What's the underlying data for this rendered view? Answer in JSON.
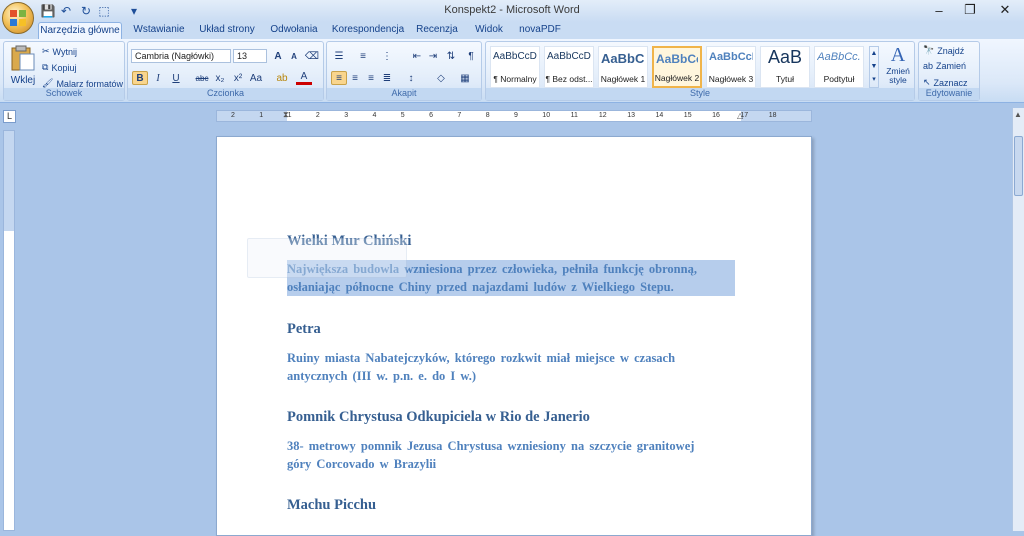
{
  "window": {
    "title": "Konspekt2 - Microsoft Word",
    "minimize": "–",
    "restore": "❐",
    "close": "✕"
  },
  "quick_access": {
    "save_icon": "save-icon",
    "undo_icon": "undo-icon",
    "redo_icon": "redo-icon",
    "customize_icon": "dropdown-icon"
  },
  "tabs": [
    {
      "label": "Narzędzia główne",
      "active": true
    },
    {
      "label": "Wstawianie"
    },
    {
      "label": "Układ strony"
    },
    {
      "label": "Odwołania"
    },
    {
      "label": "Korespondencja"
    },
    {
      "label": "Recenzja"
    },
    {
      "label": "Widok"
    },
    {
      "label": "novaPDF"
    }
  ],
  "ribbon": {
    "clipboard": {
      "label": "Schowek",
      "paste": "Wklej",
      "cut": "Wytnij",
      "copy": "Kopiuj",
      "format_painter": "Malarz formatów"
    },
    "font": {
      "label": "Czcionka",
      "font_name": "Cambria (Nagłówki)",
      "font_size": "13",
      "bold": "B",
      "italic": "I",
      "underline": "U",
      "strikethrough": "abc",
      "subscript": "x₂",
      "superscript": "x²",
      "change_case": "Aa",
      "grow": "A",
      "shrink": "A"
    },
    "paragraph": {
      "label": "Akapit"
    },
    "styles": {
      "label": "Style",
      "items": [
        {
          "sample": "AaBbCcDc",
          "name": "¶ Normalny"
        },
        {
          "sample": "AaBbCcDc",
          "name": "¶ Bez odst..."
        },
        {
          "sample": "AaBbC(",
          "name": "Nagłówek 1"
        },
        {
          "sample": "AaBbCc",
          "name": "Nagłówek 2",
          "active": true
        },
        {
          "sample": "AaBbCcI",
          "name": "Nagłówek 3"
        },
        {
          "sample": "AaB",
          "name": "Tytuł"
        },
        {
          "sample": "AaBbCc.",
          "name": "Podtytuł"
        }
      ],
      "change_styles": "Zmień style"
    },
    "editing": {
      "label": "Edytowanie",
      "find": "Znajdź",
      "replace": "Zamień",
      "select": "Zaznacz"
    }
  },
  "ruler": {
    "ticks": [
      "2",
      "1",
      "1",
      "2",
      "3",
      "4",
      "5",
      "6",
      "7",
      "8",
      "9",
      "10",
      "11",
      "12",
      "13",
      "14",
      "15",
      "16",
      "17",
      "18"
    ]
  },
  "document": {
    "sections": [
      {
        "heading": "Wielki Mur Chiński",
        "lines": [
          "Największa budowla wzniesiona przez człowieka, pełniła funkcję obronną,",
          "osłaniając północne Chiny przed najazdami ludów z Wielkiego Stepu."
        ],
        "selected": true
      },
      {
        "heading": "Petra",
        "lines_html": true,
        "lines": [
          "Ruiny miasta Nabatejczyków, którego rozkwit miał miejsce w czasach",
          "antycznych (III w. p.n. e. do I w.)"
        ]
      },
      {
        "heading": "Pomnik Chrystusa Odkupiciela w Rio de Janerio",
        "lines": [
          "38- metrowy pomnik Jezusa Chrystusa wzniesiony na szczycie granitowej",
          "góry Corcovado w Brazylii"
        ]
      },
      {
        "heading": "Machu Picchu",
        "lines": []
      }
    ]
  }
}
